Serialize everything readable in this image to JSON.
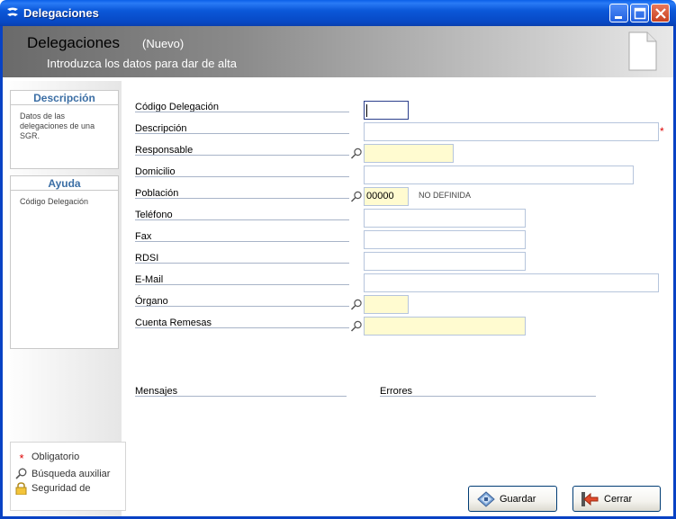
{
  "window": {
    "title": "Delegaciones"
  },
  "header": {
    "title": "Delegaciones",
    "mode": "(Nuevo)",
    "subtitle": "Introduzca los datos para dar de alta"
  },
  "sidebar": {
    "description_title": "Descripción",
    "description_text": "Datos de las delegaciones de una SGR.",
    "help_title": "Ayuda",
    "help_text": "Código Delegación"
  },
  "legend": {
    "required": "Obligatorio",
    "aux_search": "Búsqueda auxiliar",
    "security": "Seguridad de"
  },
  "form": {
    "codigo_label": "Código Delegación",
    "codigo_value": "",
    "descripcion_label": "Descripción",
    "descripcion_value": "",
    "responsable_label": "Responsable",
    "responsable_value": "",
    "domicilio_label": "Domicilio",
    "domicilio_value": "",
    "poblacion_label": "Población",
    "poblacion_value": "00000",
    "poblacion_desc": "NO DEFINIDA",
    "telefono_label": "Teléfono",
    "telefono_value": "",
    "fax_label": "Fax",
    "fax_value": "",
    "rdsi_label": "RDSI",
    "rdsi_value": "",
    "email_label": "E-Mail",
    "email_value": "",
    "organo_label": "Órgano",
    "organo_value": "",
    "cuenta_label": "Cuenta Remesas",
    "cuenta_value": "",
    "required_marker": "*"
  },
  "messages": {
    "mensajes_label": "Mensajes",
    "errores_label": "Errores"
  },
  "buttons": {
    "save": "Guardar",
    "close": "Cerrar"
  },
  "colors": {
    "titlebar": "#0a5fe8",
    "required_field": "#fffbd0",
    "panel_title": "#3b6ea5",
    "required_star": "#dd0000"
  }
}
